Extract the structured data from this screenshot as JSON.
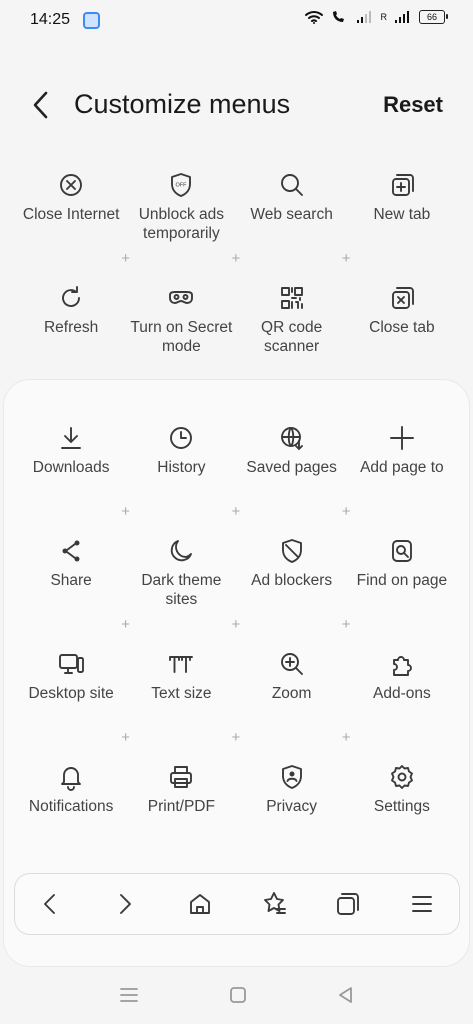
{
  "status": {
    "time": "14:25",
    "battery": "66",
    "carrier_r": "R"
  },
  "header": {
    "title": "Customize menus",
    "reset": "Reset"
  },
  "top_items": [
    {
      "label": "Close Internet",
      "icon": "close-circle-icon"
    },
    {
      "label": "Unblock ads temporarily",
      "icon": "shield-off-icon"
    },
    {
      "label": "Web search",
      "icon": "search-icon"
    },
    {
      "label": "New tab",
      "icon": "new-tab-icon"
    },
    {
      "label": "Refresh",
      "icon": "refresh-icon"
    },
    {
      "label": "Turn on Secret mode",
      "icon": "mask-icon"
    },
    {
      "label": "QR code scanner",
      "icon": "qr-code-icon"
    },
    {
      "label": "Close tab",
      "icon": "close-tab-icon"
    }
  ],
  "sheet_items": [
    {
      "label": "Downloads",
      "icon": "download-icon"
    },
    {
      "label": "History",
      "icon": "clock-icon"
    },
    {
      "label": "Saved pages",
      "icon": "saved-pages-icon"
    },
    {
      "label": "Add page to",
      "icon": "plus-icon"
    },
    {
      "label": "Share",
      "icon": "share-icon"
    },
    {
      "label": "Dark theme sites",
      "icon": "moon-icon"
    },
    {
      "label": "Ad blockers",
      "icon": "ad-block-icon"
    },
    {
      "label": "Find on page",
      "icon": "find-icon"
    },
    {
      "label": "Desktop site",
      "icon": "desktop-icon"
    },
    {
      "label": "Text size",
      "icon": "text-size-icon"
    },
    {
      "label": "Zoom",
      "icon": "zoom-icon"
    },
    {
      "label": "Add-ons",
      "icon": "puzzle-icon"
    },
    {
      "label": "Notifications",
      "icon": "bell-icon"
    },
    {
      "label": "Print/PDF",
      "icon": "printer-icon"
    },
    {
      "label": "Privacy",
      "icon": "privacy-icon"
    },
    {
      "label": "Settings",
      "icon": "gear-icon"
    }
  ],
  "toolbar": [
    "back-icon",
    "forward-icon",
    "home-icon",
    "bookmarks-icon",
    "tabs-icon",
    "menu-icon"
  ],
  "plus_sign": "+"
}
